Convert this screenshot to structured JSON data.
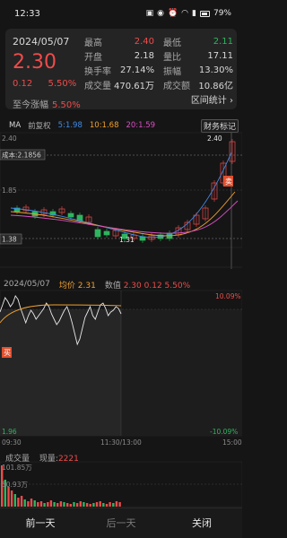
{
  "status": {
    "time": "12:33",
    "battery": "79%"
  },
  "quote": {
    "date": "2024/05/07",
    "price": "2.30",
    "change": "0.12",
    "change_pct": "5.50%",
    "today_label": "至今涨幅",
    "today_value": "5.50%",
    "rows": [
      {
        "l1": "最高",
        "v1": "2.40",
        "c1": "red",
        "l2": "最低",
        "v2": "2.11",
        "c2": "green"
      },
      {
        "l1": "开盘",
        "v1": "2.18",
        "c1": "wht",
        "l2": "量比",
        "v2": "17.11",
        "c2": "wht"
      },
      {
        "l1": "换手率",
        "v1": "27.14%",
        "c1": "wht",
        "l2": "振幅",
        "v2": "13.30%",
        "c2": "wht"
      },
      {
        "l1": "成交量",
        "v1": "470.61万",
        "c1": "wht",
        "l2": "成交额",
        "v2": "10.86亿",
        "c2": "wht"
      }
    ],
    "interval_stat": "区间统计 ›"
  },
  "ma": {
    "label": "MA",
    "adjust": "前复权",
    "ma5": "5:1.98",
    "ma10": "10:1.68",
    "ma20": "20:1.59",
    "fin_tag": "财务标记",
    "colors": {
      "ma5": "#3f8be8",
      "ma10": "#f0a030",
      "ma20": "#d94fc2"
    }
  },
  "kline": {
    "y_top": "2.40",
    "y_mid": "1.85",
    "cost_label": "成本:2.1856",
    "y_low": "1.38",
    "high_label": "2.40",
    "low_label": "1.31",
    "sell_tag": "卖"
  },
  "intraday": {
    "date": "2024/05/07",
    "avg_label": "均价",
    "avg_value": "2.31",
    "num_label": "数值",
    "num_price": "2.30",
    "num_chg": "0.12",
    "num_pct": "5.50%",
    "pct_top": "10.09%",
    "pct_bottom": "-10.09%",
    "price_bottom": "1.96",
    "buy_tag": "买",
    "t_start": "09:30",
    "t_mid": "11:30/13:00",
    "t_end": "15:00"
  },
  "volume": {
    "label": "成交量",
    "now_label": "现量:",
    "now_value": "2221",
    "y_top": "101.85万",
    "y_mid": "50.93万"
  },
  "nav": {
    "prev": "前一天",
    "next": "后一天",
    "close": "关闭"
  }
}
